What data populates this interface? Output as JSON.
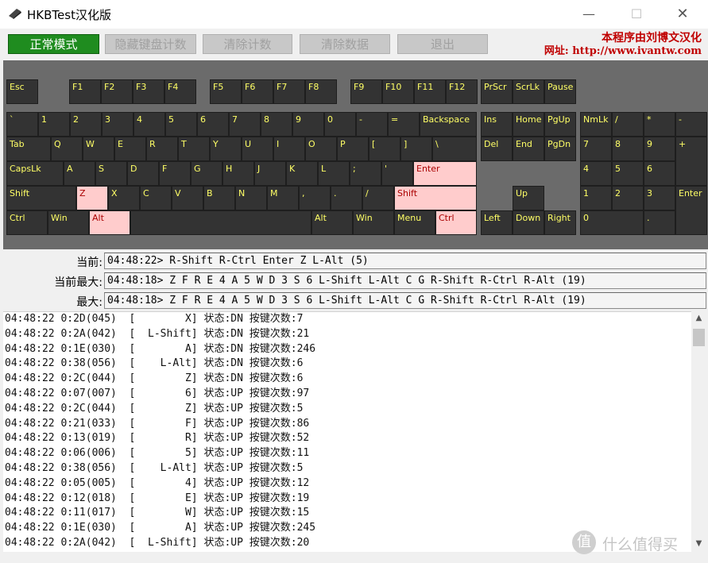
{
  "window": {
    "title": "HKBTest汉化版",
    "minimize": "—",
    "maximize": "☐",
    "close": "✕"
  },
  "toolbar": {
    "normal_mode": "正常模式",
    "hide_counts": "隐藏键盘计数",
    "clear_counts": "清除计数",
    "clear_data": "清除数据",
    "exit": "退出"
  },
  "brand": {
    "line1": "本程序由刘博文汉化",
    "line2_prefix": "网址:",
    "line2_url": "http://www.ivantw.com"
  },
  "colors": {
    "key_bg": "#333333",
    "key_text": "#ffff66",
    "key_pressed_bg": "#ffcccc",
    "active_button": "#1f8c1f",
    "brand_red": "#c00000"
  },
  "keys": [
    {
      "id": "esc",
      "label": "Esc"
    },
    {
      "id": "f1",
      "label": "F1"
    },
    {
      "id": "f2",
      "label": "F2"
    },
    {
      "id": "f3",
      "label": "F3"
    },
    {
      "id": "f4",
      "label": "F4"
    },
    {
      "id": "f5",
      "label": "F5"
    },
    {
      "id": "f6",
      "label": "F6"
    },
    {
      "id": "f7",
      "label": "F7"
    },
    {
      "id": "f8",
      "label": "F8"
    },
    {
      "id": "f9",
      "label": "F9"
    },
    {
      "id": "f10",
      "label": "F10"
    },
    {
      "id": "f11",
      "label": "F11"
    },
    {
      "id": "f12",
      "label": "F12"
    },
    {
      "id": "prscr",
      "label": "PrScr"
    },
    {
      "id": "scrlk",
      "label": "ScrLk"
    },
    {
      "id": "pause",
      "label": "Pause"
    },
    {
      "id": "grave",
      "label": "`"
    },
    {
      "id": "k1",
      "label": "1"
    },
    {
      "id": "k2",
      "label": "2"
    },
    {
      "id": "k3",
      "label": "3"
    },
    {
      "id": "k4",
      "label": "4"
    },
    {
      "id": "k5",
      "label": "5"
    },
    {
      "id": "k6",
      "label": "6"
    },
    {
      "id": "k7",
      "label": "7"
    },
    {
      "id": "k8",
      "label": "8"
    },
    {
      "id": "k9",
      "label": "9"
    },
    {
      "id": "k0",
      "label": "0"
    },
    {
      "id": "minus",
      "label": "-"
    },
    {
      "id": "equal",
      "label": "="
    },
    {
      "id": "backspace",
      "label": "Backspace"
    },
    {
      "id": "ins",
      "label": "Ins"
    },
    {
      "id": "home",
      "label": "Home"
    },
    {
      "id": "pgup",
      "label": "PgUp"
    },
    {
      "id": "numlk",
      "label": "NmLk"
    },
    {
      "id": "npdiv",
      "label": "/"
    },
    {
      "id": "npmul",
      "label": "*"
    },
    {
      "id": "npsub",
      "label": "-"
    },
    {
      "id": "tab",
      "label": "Tab"
    },
    {
      "id": "q",
      "label": "Q"
    },
    {
      "id": "w",
      "label": "W"
    },
    {
      "id": "e",
      "label": "E"
    },
    {
      "id": "r",
      "label": "R"
    },
    {
      "id": "t",
      "label": "T"
    },
    {
      "id": "y",
      "label": "Y"
    },
    {
      "id": "u",
      "label": "U"
    },
    {
      "id": "i",
      "label": "I"
    },
    {
      "id": "o",
      "label": "O"
    },
    {
      "id": "p",
      "label": "P"
    },
    {
      "id": "lbracket",
      "label": "["
    },
    {
      "id": "rbracket",
      "label": "]"
    },
    {
      "id": "backslash",
      "label": "\\"
    },
    {
      "id": "del",
      "label": "Del"
    },
    {
      "id": "end",
      "label": "End"
    },
    {
      "id": "pgdn",
      "label": "PgDn"
    },
    {
      "id": "np7",
      "label": "7"
    },
    {
      "id": "np8",
      "label": "8"
    },
    {
      "id": "np9",
      "label": "9"
    },
    {
      "id": "npadd",
      "label": "+"
    },
    {
      "id": "capslk",
      "label": "CapsLk"
    },
    {
      "id": "a",
      "label": "A"
    },
    {
      "id": "s",
      "label": "S"
    },
    {
      "id": "d",
      "label": "D"
    },
    {
      "id": "f",
      "label": "F"
    },
    {
      "id": "g",
      "label": "G"
    },
    {
      "id": "h",
      "label": "H"
    },
    {
      "id": "j",
      "label": "J"
    },
    {
      "id": "k",
      "label": "K"
    },
    {
      "id": "l",
      "label": "L"
    },
    {
      "id": "semicolon",
      "label": ";"
    },
    {
      "id": "quote",
      "label": "'"
    },
    {
      "id": "enter",
      "label": "Enter",
      "pressed": true
    },
    {
      "id": "np4",
      "label": "4"
    },
    {
      "id": "np5",
      "label": "5"
    },
    {
      "id": "np6",
      "label": "6"
    },
    {
      "id": "lshift",
      "label": "Shift"
    },
    {
      "id": "z",
      "label": "Z",
      "pressed": true
    },
    {
      "id": "x",
      "label": "X"
    },
    {
      "id": "c",
      "label": "C"
    },
    {
      "id": "v",
      "label": "V"
    },
    {
      "id": "b",
      "label": "B"
    },
    {
      "id": "n",
      "label": "N"
    },
    {
      "id": "m",
      "label": "M"
    },
    {
      "id": "comma",
      "label": ","
    },
    {
      "id": "period",
      "label": "."
    },
    {
      "id": "slash",
      "label": "/"
    },
    {
      "id": "rshift",
      "label": "Shift",
      "pressed": true
    },
    {
      "id": "up",
      "label": "Up"
    },
    {
      "id": "np1",
      "label": "1"
    },
    {
      "id": "np2",
      "label": "2"
    },
    {
      "id": "np3",
      "label": "3"
    },
    {
      "id": "npenter",
      "label": "Enter"
    },
    {
      "id": "lctrl",
      "label": "Ctrl"
    },
    {
      "id": "lwin",
      "label": "Win"
    },
    {
      "id": "lalt",
      "label": "Alt",
      "pressed": true
    },
    {
      "id": "space",
      "label": ""
    },
    {
      "id": "ralt",
      "label": "Alt"
    },
    {
      "id": "rwin",
      "label": "Win"
    },
    {
      "id": "menu",
      "label": "Menu"
    },
    {
      "id": "rctrl",
      "label": "Ctrl",
      "pressed": true
    },
    {
      "id": "left",
      "label": "Left"
    },
    {
      "id": "down",
      "label": "Down"
    },
    {
      "id": "right",
      "label": "Right"
    },
    {
      "id": "np0",
      "label": "0"
    },
    {
      "id": "npdot",
      "label": "."
    }
  ],
  "status": {
    "current_label": "当前:",
    "current_value": "04:48:22> R-Shift R-Ctrl Enter Z L-Alt (5)",
    "current_max_label": "当前最大:",
    "current_max_value": "04:48:18> Z F R E 4 A 5 W D 3 S 6 L-Shift L-Alt C G R-Shift R-Ctrl R-Alt (19)",
    "max_label": "最大:",
    "max_value": "04:48:18> Z F R E 4 A 5 W D 3 S 6 L-Shift L-Alt C G R-Shift R-Ctrl R-Alt (19)"
  },
  "log": [
    "04:48:22 0:2D(045)  [        X] 状态:DN 按键次数:7",
    "04:48:22 0:2A(042)  [  L-Shift] 状态:DN 按键次数:21",
    "04:48:22 0:1E(030)  [        A] 状态:DN 按键次数:246",
    "04:48:22 0:38(056)  [    L-Alt] 状态:DN 按键次数:6",
    "04:48:22 0:2C(044)  [        Z] 状态:DN 按键次数:6",
    "04:48:22 0:07(007)  [        6] 状态:UP 按键次数:97",
    "04:48:22 0:2C(044)  [        Z] 状态:UP 按键次数:5",
    "04:48:22 0:21(033)  [        F] 状态:UP 按键次数:86",
    "04:48:22 0:13(019)  [        R] 状态:UP 按键次数:52",
    "04:48:22 0:06(006)  [        5] 状态:UP 按键次数:11",
    "04:48:22 0:38(056)  [    L-Alt] 状态:UP 按键次数:5",
    "04:48:22 0:05(005)  [        4] 状态:UP 按键次数:12",
    "04:48:22 0:12(018)  [        E] 状态:UP 按键次数:19",
    "04:48:22 0:11(017)  [        W] 状态:UP 按键次数:15",
    "04:48:22 0:1E(030)  [        A] 状态:UP 按键次数:245",
    "04:48:22 0:2A(042)  [  L-Shift] 状态:UP 按键次数:20"
  ],
  "watermark": {
    "logo": "值",
    "text": "什么值得买"
  }
}
